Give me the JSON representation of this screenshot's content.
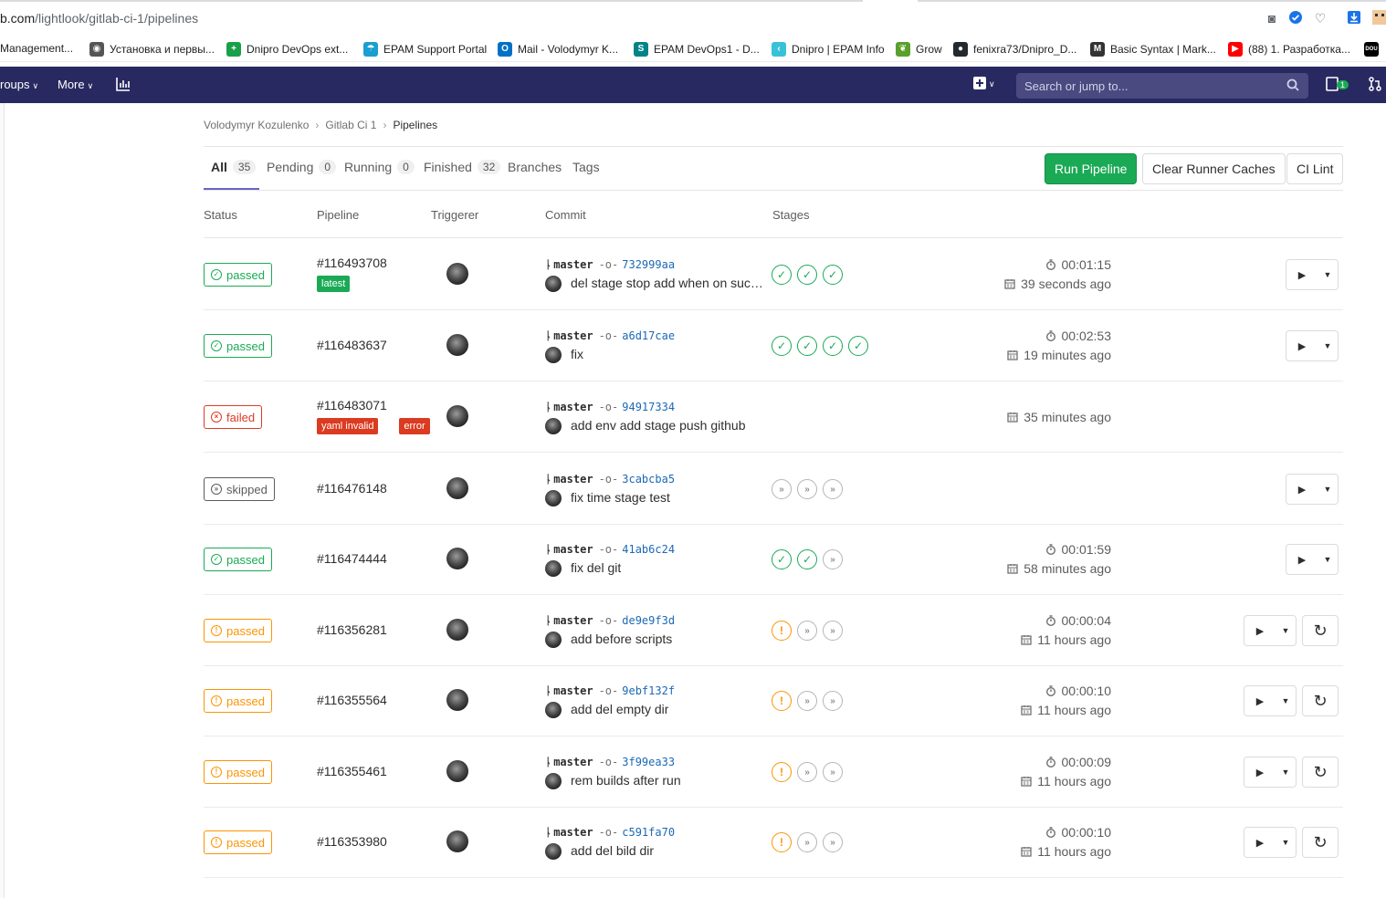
{
  "browser": {
    "url_prefix": "b.com",
    "url_path": "/lightlook/gitlab-ci-1/pipelines",
    "bookmarks": [
      {
        "label": "Management...",
        "icon": "doc-icon",
        "color": "#7a7a7a"
      },
      {
        "label": "Установка и первы...",
        "icon": "globe-icon",
        "color": "#555555"
      },
      {
        "label": "Dnipro DevOps ext...",
        "icon": "plus-icon",
        "color": "#1a9f4a"
      },
      {
        "label": "EPAM Support Portal",
        "icon": "umbrella-icon",
        "color": "#1a9fd0"
      },
      {
        "label": "Mail - Volodymyr K...",
        "icon": "outlook-icon",
        "color": "#0072c6"
      },
      {
        "label": "EPAM DevOps1 - D...",
        "icon": "sharepoint-icon",
        "color": "#038387"
      },
      {
        "label": "Dnipro | EPAM Info",
        "icon": "code-icon",
        "color": "#39c2d7"
      },
      {
        "label": "Grow",
        "icon": "leaf-icon",
        "color": "#5aa02c"
      },
      {
        "label": "fenixra73/Dnipro_D...",
        "icon": "github-icon",
        "color": "#24292e"
      },
      {
        "label": "Basic Syntax | Mark...",
        "icon": "markdown-icon",
        "color": "#333333"
      },
      {
        "label": "(88) 1. Разработка...",
        "icon": "youtube-icon",
        "color": "#ff0000"
      },
      {
        "label": "DOU",
        "icon": "dou-icon",
        "color": "#000000"
      }
    ]
  },
  "nav": {
    "groups_label": "roups",
    "more_label": "More",
    "search_placeholder": "Search or jump to...",
    "todo_count": "1"
  },
  "breadcrumb": [
    "Volodymyr Kozulenko",
    "Gitlab Ci 1",
    "Pipelines"
  ],
  "tabs": [
    {
      "label": "All",
      "count": "35"
    },
    {
      "label": "Pending",
      "count": "0"
    },
    {
      "label": "Running",
      "count": "0"
    },
    {
      "label": "Finished",
      "count": "32"
    },
    {
      "label": "Branches",
      "count": ""
    },
    {
      "label": "Tags",
      "count": ""
    }
  ],
  "buttons": {
    "run_pipeline": "Run Pipeline",
    "clear_caches": "Clear Runner Caches",
    "ci_lint": "CI Lint"
  },
  "columns": [
    "Status",
    "Pipeline",
    "Triggerer",
    "Commit",
    "Stages"
  ],
  "colors": {
    "success": "#1aaa55",
    "failed": "#db3b21",
    "warning": "#fc9403",
    "nav": "#292961",
    "link": "#1b69b6"
  },
  "pipelines": [
    {
      "status": "passed",
      "kind": "passed",
      "id": "#116493708",
      "tags": [
        {
          "text": "latest",
          "color": "green"
        }
      ],
      "branch": "master",
      "sha": "732999aa",
      "message": "del stage stop add when on succ...",
      "stages": [
        "success",
        "success",
        "success"
      ],
      "duration": "00:01:15",
      "finished": "39 seconds ago",
      "actions": [
        "play"
      ]
    },
    {
      "status": "passed",
      "kind": "passed",
      "id": "#116483637",
      "tags": [],
      "branch": "master",
      "sha": "a6d17cae",
      "message": "fix",
      "stages": [
        "success",
        "success",
        "success",
        "success"
      ],
      "duration": "00:02:53",
      "finished": "19 minutes ago",
      "actions": [
        "play"
      ]
    },
    {
      "status": "failed",
      "kind": "failed",
      "id": "#116483071",
      "tags": [
        {
          "text": "yaml invalid",
          "color": "red"
        },
        {
          "text": "error",
          "color": "red"
        }
      ],
      "branch": "master",
      "sha": "94917334",
      "message": "add env add stage push github",
      "stages": [],
      "duration": "",
      "finished": "35 minutes ago",
      "actions": []
    },
    {
      "status": "skipped",
      "kind": "skipped",
      "id": "#116476148",
      "tags": [],
      "branch": "master",
      "sha": "3cabcba5",
      "message": "fix time stage test",
      "stages": [
        "skipped",
        "skipped",
        "skipped"
      ],
      "duration": "",
      "finished": "",
      "actions": [
        "play"
      ]
    },
    {
      "status": "passed",
      "kind": "passed",
      "id": "#116474444",
      "tags": [],
      "branch": "master",
      "sha": "41ab6c24",
      "message": "fix del git",
      "stages": [
        "success",
        "success",
        "skipped"
      ],
      "duration": "00:01:59",
      "finished": "58 minutes ago",
      "actions": [
        "play"
      ]
    },
    {
      "status": "passed",
      "kind": "warning",
      "id": "#116356281",
      "tags": [],
      "branch": "master",
      "sha": "de9e9f3d",
      "message": "add before scripts",
      "stages": [
        "warning",
        "skipped",
        "skipped"
      ],
      "duration": "00:00:04",
      "finished": "11 hours ago",
      "actions": [
        "play",
        "retry"
      ]
    },
    {
      "status": "passed",
      "kind": "warning",
      "id": "#116355564",
      "tags": [],
      "branch": "master",
      "sha": "9ebf132f",
      "message": "add del empty dir",
      "stages": [
        "warning",
        "skipped",
        "skipped"
      ],
      "duration": "00:00:10",
      "finished": "11 hours ago",
      "actions": [
        "play",
        "retry"
      ]
    },
    {
      "status": "passed",
      "kind": "warning",
      "id": "#116355461",
      "tags": [],
      "branch": "master",
      "sha": "3f99ea33",
      "message": "rem builds after run",
      "stages": [
        "warning",
        "skipped",
        "skipped"
      ],
      "duration": "00:00:09",
      "finished": "11 hours ago",
      "actions": [
        "play",
        "retry"
      ]
    },
    {
      "status": "passed",
      "kind": "warning",
      "id": "#116353980",
      "tags": [],
      "branch": "master",
      "sha": "c591fa70",
      "message": "add del bild dir",
      "stages": [
        "warning",
        "skipped",
        "skipped"
      ],
      "duration": "00:00:10",
      "finished": "11 hours ago",
      "actions": [
        "play",
        "retry"
      ]
    }
  ]
}
